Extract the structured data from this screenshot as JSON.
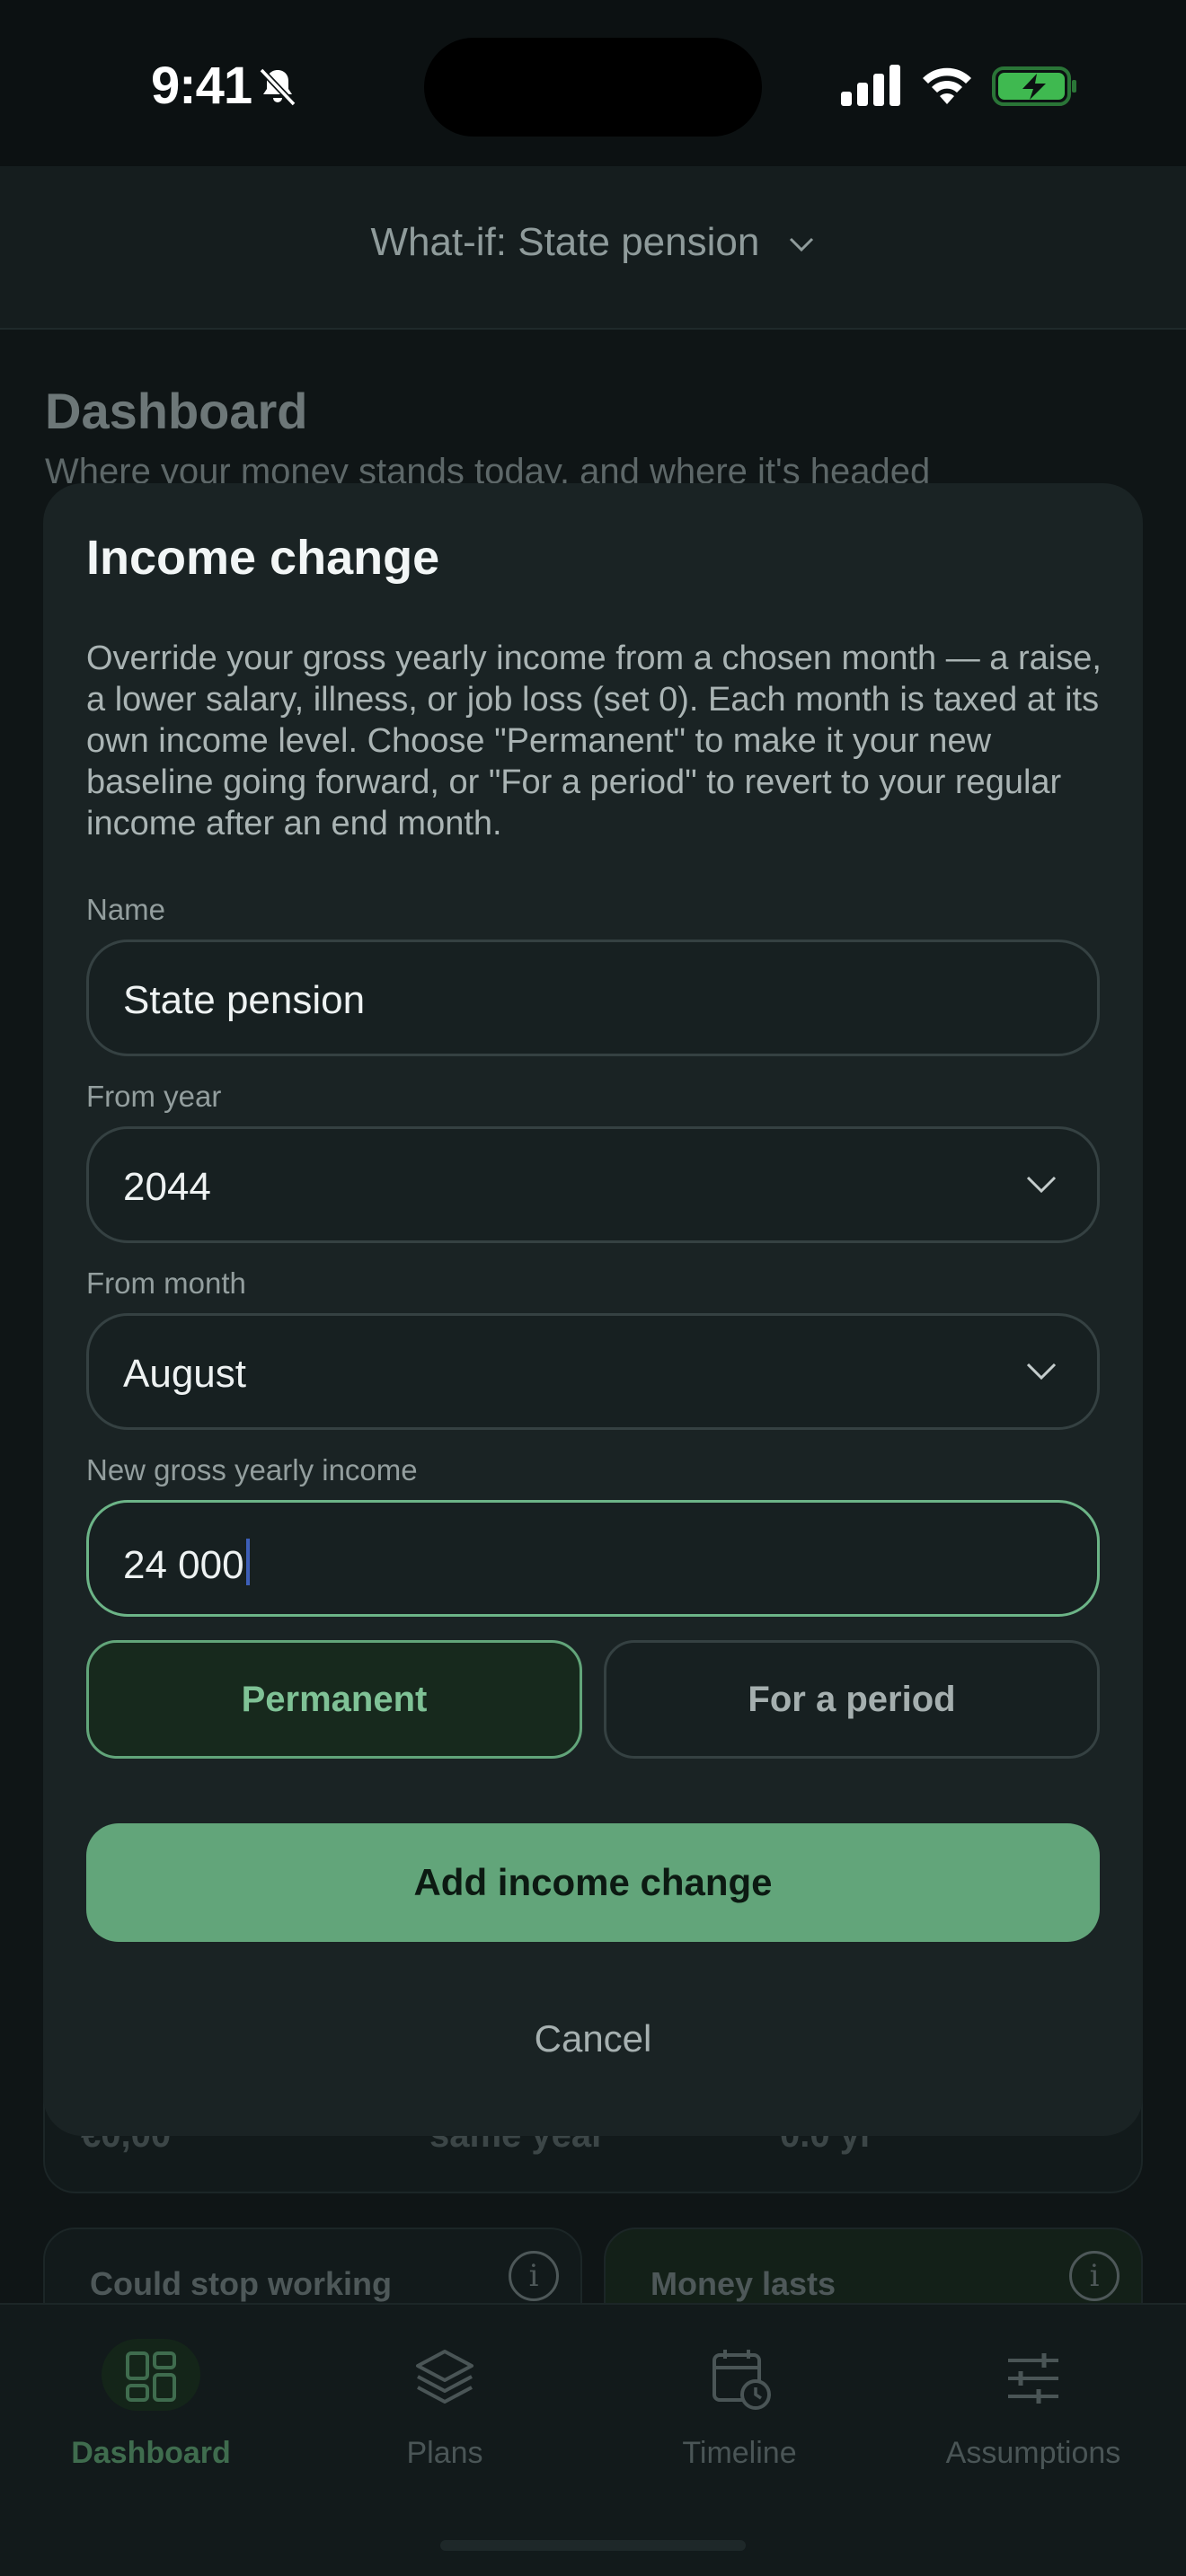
{
  "status_bar": {
    "time": "9:41",
    "icons": [
      "bell-slash-icon",
      "cellular-signal-icon",
      "wifi-icon",
      "battery-charging-icon"
    ],
    "battery_color": "#3fb950"
  },
  "header": {
    "scenario_label": "What-if: State pension"
  },
  "dashboard": {
    "title": "Dashboard",
    "subtitle": "Where your money stands today, and where it's headed",
    "peek_values": [
      "€0,00",
      "same year",
      "0.0 yr"
    ],
    "cards": [
      {
        "label": "Could stop working",
        "icon": "info-icon"
      },
      {
        "label": "Money lasts",
        "icon": "info-icon"
      }
    ]
  },
  "modal": {
    "title": "Income change",
    "description": "Override your gross yearly income from a chosen month — a raise, a lower salary, illness, or job loss (set 0). Each month is taxed at its own income level. Choose \"Permanent\" to make it your new baseline going forward, or \"For a period\" to revert to your regular income after an end month.",
    "name_label": "Name",
    "name_value": "State pension",
    "from_year_label": "From year",
    "from_year_value": "2044",
    "from_month_label": "From month",
    "from_month_value": "August",
    "income_label": "New gross yearly income",
    "income_value": "24 000",
    "duration_options": [
      "Permanent",
      "For a period"
    ],
    "duration_selected": "Permanent",
    "submit_label": "Add income change",
    "cancel_label": "Cancel"
  },
  "tab_bar": {
    "tabs": [
      {
        "label": "Dashboard",
        "icon": "grid-icon",
        "active": true
      },
      {
        "label": "Plans",
        "icon": "layers-icon",
        "active": false
      },
      {
        "label": "Timeline",
        "icon": "calendar-clock-icon",
        "active": false
      },
      {
        "label": "Assumptions",
        "icon": "sliders-icon",
        "active": false
      }
    ]
  },
  "colors": {
    "accent": "#62a57a",
    "accent_text": "#7fc296",
    "modal_bg": "#1a2324",
    "page_bg": "#0f1516"
  }
}
